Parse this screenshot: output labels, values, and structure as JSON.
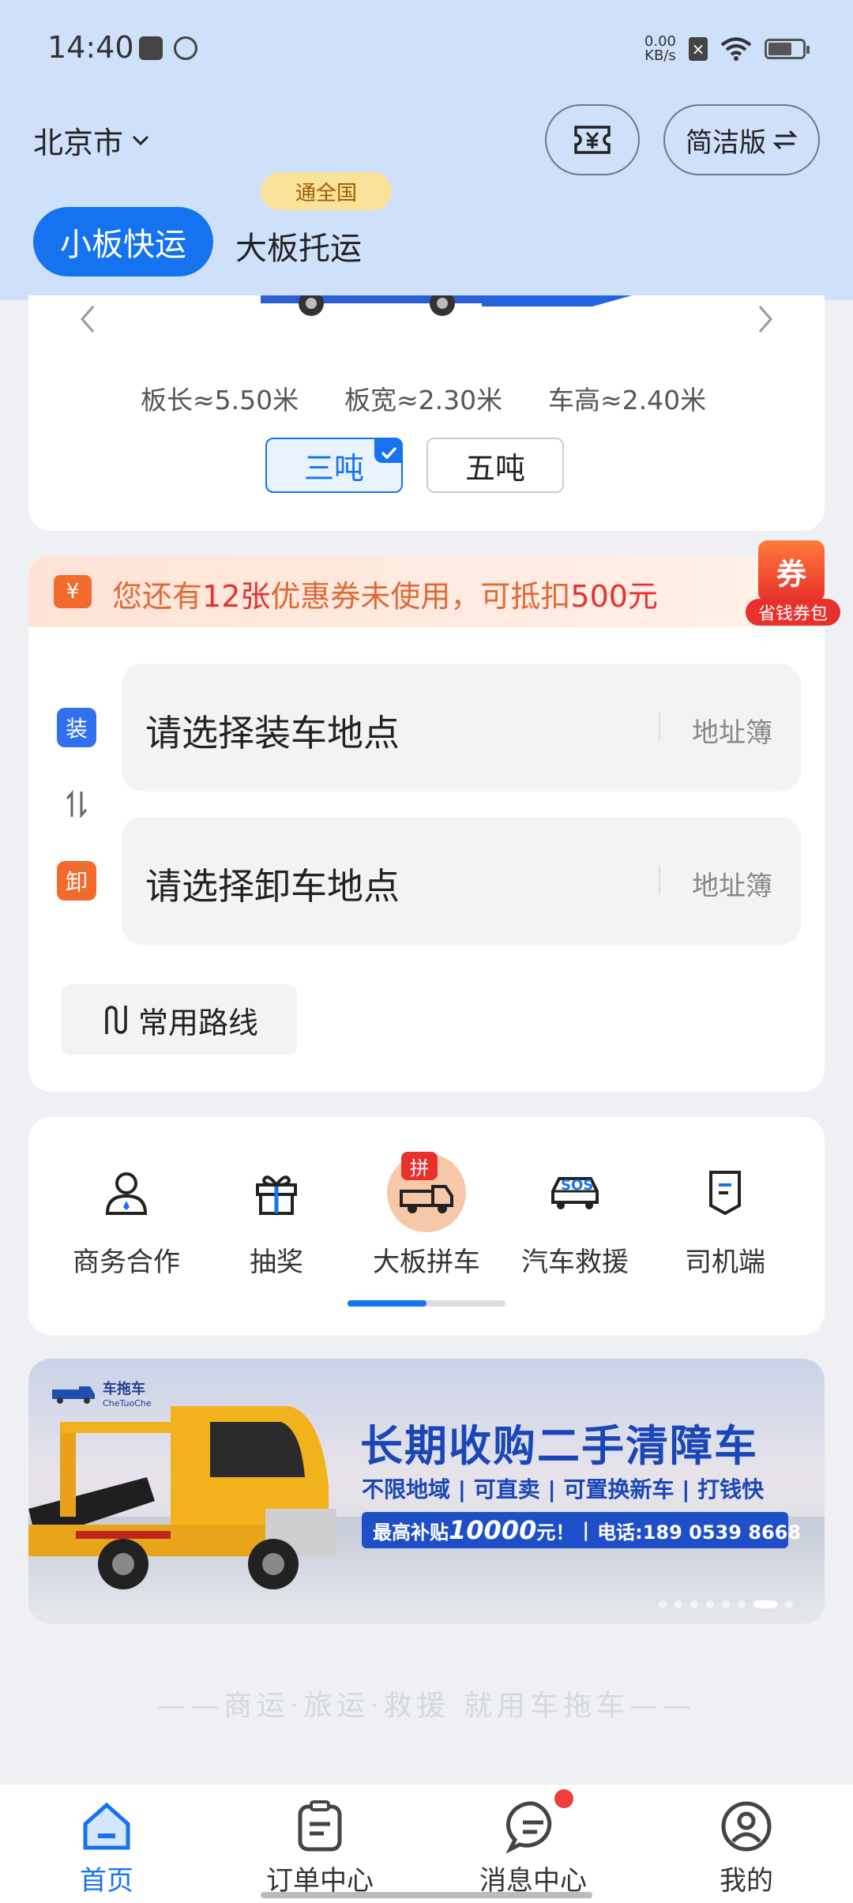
{
  "status_bar": {
    "time": "14:40",
    "net_speed_value": "0.00",
    "net_speed_unit": "KB/s",
    "battery_level": 0.7
  },
  "header": {
    "city": "北京市",
    "mode_button": "简洁版",
    "tabs": [
      {
        "label": "小板快运",
        "active": true
      },
      {
        "label": "大板托运",
        "active": false
      }
    ],
    "tab_badge": "通全国"
  },
  "vehicle": {
    "length": "板长≈5.50米",
    "width": "板宽≈2.30米",
    "height": "车高≈2.40米",
    "weights": [
      {
        "label": "三吨",
        "selected": true
      },
      {
        "label": "五吨",
        "selected": false
      }
    ]
  },
  "coupon": {
    "text_prefix": "您还有",
    "count": "12张",
    "text_mid": "优惠券未使用，可抵扣",
    "amount": "500元",
    "icon_glyph": "¥",
    "badge_glyph": "券",
    "badge_label": "省钱券包"
  },
  "route": {
    "load_tag": "装",
    "unload_tag": "卸",
    "load_placeholder": "请选择装车地点",
    "unload_placeholder": "请选择卸车地点",
    "address_book": "地址簿",
    "common_routes": "常用路线"
  },
  "services": [
    {
      "label": "商务合作",
      "icon": "business-person-icon"
    },
    {
      "label": "抽奖",
      "icon": "gift-icon"
    },
    {
      "label": "大板拼车",
      "icon": "carpool-truck-icon",
      "badge": "拼"
    },
    {
      "label": "汽车救援",
      "icon": "sos-car-icon",
      "sos": "SOS"
    },
    {
      "label": "司机端",
      "icon": "driver-doc-icon"
    }
  ],
  "banner": {
    "brand": "车拖车",
    "brand_en": "CheTuoChe",
    "headline": "长期收购二手清障车",
    "subline": "不限地域 | 可直卖 | 可置换新车 | 打钱快",
    "subsidy_prefix": "最高补贴",
    "subsidy_amount": "10000",
    "subsidy_suffix": "元！",
    "phone": "电话:189 0539 8668",
    "slide_count": 8,
    "active_slide": 6
  },
  "slogan": "——商运·旅运·救援 就用车拖车——",
  "nav": [
    {
      "label": "首页",
      "active": true,
      "icon": "home-icon"
    },
    {
      "label": "订单中心",
      "active": false,
      "icon": "order-icon"
    },
    {
      "label": "消息中心",
      "active": false,
      "icon": "message-icon",
      "dot": true
    },
    {
      "label": "我的",
      "active": false,
      "icon": "profile-icon"
    }
  ],
  "colors": {
    "primary": "#1673f0",
    "orange": "#f26b2c",
    "coupon_red": "#e8502d"
  }
}
